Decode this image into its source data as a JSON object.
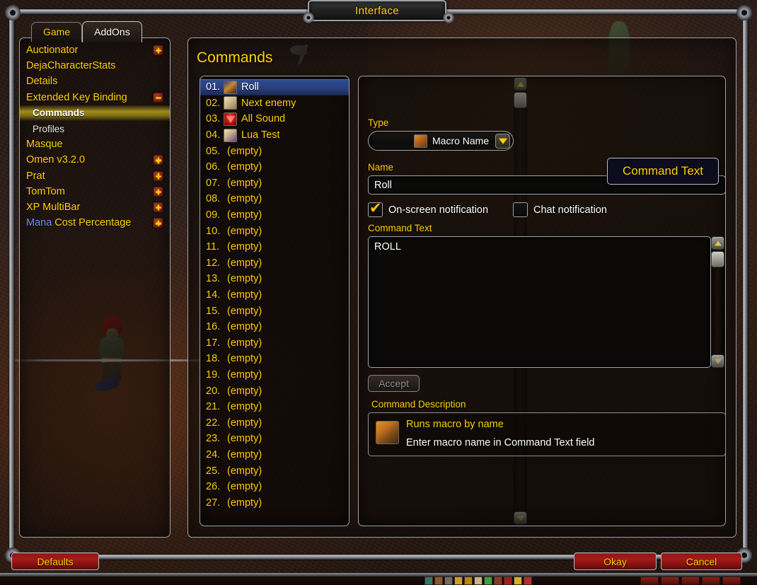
{
  "window": {
    "title": "Interface"
  },
  "tabs": [
    {
      "label": "Game",
      "active": false
    },
    {
      "label": "AddOns",
      "active": true
    }
  ],
  "sidebar": {
    "items": [
      {
        "label": "Auctionator",
        "child": false,
        "selected": false,
        "toggle": "plus"
      },
      {
        "label": "DejaCharacterStats",
        "child": false,
        "selected": false,
        "toggle": null
      },
      {
        "label": "Details",
        "child": false,
        "selected": false,
        "toggle": null
      },
      {
        "label": "Extended Key Binding",
        "child": false,
        "selected": false,
        "toggle": "minus"
      },
      {
        "label": "Commands",
        "child": true,
        "selected": true,
        "toggle": null
      },
      {
        "label": "Profiles",
        "child": true,
        "selected": false,
        "toggle": null
      },
      {
        "label": "Masque",
        "child": false,
        "selected": false,
        "toggle": null
      },
      {
        "label": "Omen v3.2.0",
        "child": false,
        "selected": false,
        "toggle": "plus"
      },
      {
        "label": "Prat",
        "child": false,
        "selected": false,
        "toggle": "plus"
      },
      {
        "label": "TomTom",
        "child": false,
        "selected": false,
        "toggle": "plus"
      },
      {
        "label": "XP MultiBar",
        "child": false,
        "selected": false,
        "toggle": "plus"
      },
      {
        "label": "Mana Cost Percentage",
        "child": false,
        "selected": false,
        "toggle": "plus",
        "split": [
          "Mana",
          " Cost Percentage"
        ]
      }
    ]
  },
  "content": {
    "title": "Commands"
  },
  "command_list": [
    {
      "num": "01.",
      "name": "Roll",
      "icon": "macro-icon",
      "selected": true,
      "empty": false
    },
    {
      "num": "02.",
      "name": "Next enemy",
      "icon": "scroll-icon",
      "selected": false,
      "empty": false
    },
    {
      "num": "03.",
      "name": "All Sound",
      "icon": "sound-icon",
      "selected": false,
      "empty": false
    },
    {
      "num": "04.",
      "name": "Lua Test",
      "icon": "lua-icon",
      "selected": false,
      "empty": false
    },
    {
      "num": "05.",
      "name": "(empty)",
      "icon": null,
      "selected": false,
      "empty": true
    },
    {
      "num": "06.",
      "name": "(empty)",
      "icon": null,
      "selected": false,
      "empty": true
    },
    {
      "num": "07.",
      "name": "(empty)",
      "icon": null,
      "selected": false,
      "empty": true
    },
    {
      "num": "08.",
      "name": "(empty)",
      "icon": null,
      "selected": false,
      "empty": true
    },
    {
      "num": "09.",
      "name": "(empty)",
      "icon": null,
      "selected": false,
      "empty": true
    },
    {
      "num": "10.",
      "name": "(empty)",
      "icon": null,
      "selected": false,
      "empty": true
    },
    {
      "num": "11.",
      "name": "(empty)",
      "icon": null,
      "selected": false,
      "empty": true
    },
    {
      "num": "12.",
      "name": "(empty)",
      "icon": null,
      "selected": false,
      "empty": true
    },
    {
      "num": "13.",
      "name": "(empty)",
      "icon": null,
      "selected": false,
      "empty": true
    },
    {
      "num": "14.",
      "name": "(empty)",
      "icon": null,
      "selected": false,
      "empty": true
    },
    {
      "num": "15.",
      "name": "(empty)",
      "icon": null,
      "selected": false,
      "empty": true
    },
    {
      "num": "16.",
      "name": "(empty)",
      "icon": null,
      "selected": false,
      "empty": true
    },
    {
      "num": "17.",
      "name": "(empty)",
      "icon": null,
      "selected": false,
      "empty": true
    },
    {
      "num": "18.",
      "name": "(empty)",
      "icon": null,
      "selected": false,
      "empty": true
    },
    {
      "num": "19.",
      "name": "(empty)",
      "icon": null,
      "selected": false,
      "empty": true
    },
    {
      "num": "20.",
      "name": "(empty)",
      "icon": null,
      "selected": false,
      "empty": true
    },
    {
      "num": "21.",
      "name": "(empty)",
      "icon": null,
      "selected": false,
      "empty": true
    },
    {
      "num": "22.",
      "name": "(empty)",
      "icon": null,
      "selected": false,
      "empty": true
    },
    {
      "num": "23.",
      "name": "(empty)",
      "icon": null,
      "selected": false,
      "empty": true
    },
    {
      "num": "24.",
      "name": "(empty)",
      "icon": null,
      "selected": false,
      "empty": true
    },
    {
      "num": "25.",
      "name": "(empty)",
      "icon": null,
      "selected": false,
      "empty": true
    },
    {
      "num": "26.",
      "name": "(empty)",
      "icon": null,
      "selected": false,
      "empty": true
    },
    {
      "num": "27.",
      "name": "(empty)",
      "icon": null,
      "selected": false,
      "empty": true
    }
  ],
  "form": {
    "type_label": "Type",
    "type_value": "Macro Name",
    "name_label": "Name",
    "name_value": "Roll",
    "onscreen_label": "On-screen notification",
    "onscreen_checked": true,
    "chat_label": "Chat notification",
    "chat_checked": false,
    "command_text_label": "Command Text",
    "command_text_value": "ROLL",
    "accept_label": "Accept",
    "description_label": "Command Description",
    "description_title": "Runs macro by name",
    "description_sub": "Enter macro name in Command Text field"
  },
  "tooltip": {
    "text": "Command Text"
  },
  "footer": {
    "defaults": "Defaults",
    "okay": "Okay",
    "cancel": "Cancel"
  },
  "colors": {
    "gold": "#ffd100",
    "white": "#ffffff",
    "selection_blue": "#2e4a8d",
    "selection_gold": "#c8af1e",
    "button_red": "#a81a1a",
    "mana_blue": "#6f8ff0",
    "frame_silver": "#9ea2a8"
  }
}
